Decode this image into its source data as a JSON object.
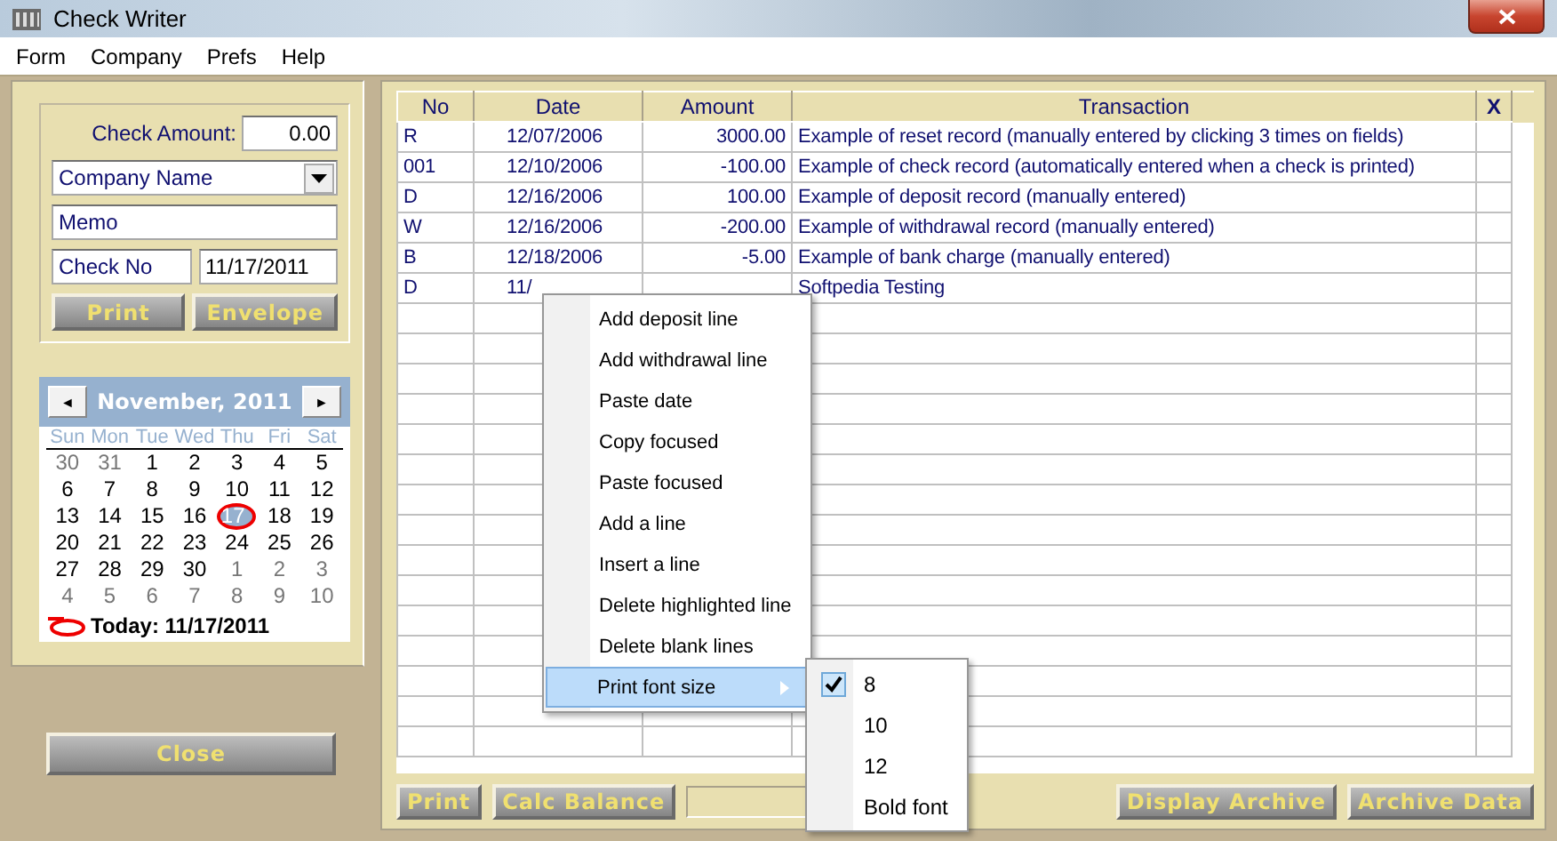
{
  "window": {
    "title": "Check Writer"
  },
  "menu": [
    "Form",
    "Company",
    "Prefs",
    "Help"
  ],
  "check_form": {
    "amount_label": "Check Amount:",
    "amount": "0.00",
    "company": "Company Name",
    "memo": "Memo",
    "check_no": "Check No",
    "date": "11/17/2011",
    "buttons": [
      "Print",
      "Envelope"
    ]
  },
  "calendar": {
    "month": "November, 2011",
    "prev": "◄",
    "next": "►",
    "weekdays": [
      "Sun",
      "Mon",
      "Tue",
      "Wed",
      "Thu",
      "Fri",
      "Sat"
    ],
    "weeks": [
      [
        {
          "day": "30",
          "other_month": true,
          "selected": false
        },
        {
          "day": "31",
          "other_month": true,
          "selected": false
        },
        {
          "day": "1",
          "other_month": false,
          "selected": false
        },
        {
          "day": "2",
          "other_month": false,
          "selected": false
        },
        {
          "day": "3",
          "other_month": false,
          "selected": false
        },
        {
          "day": "4",
          "other_month": false,
          "selected": false
        },
        {
          "day": "5",
          "other_month": false,
          "selected": false
        }
      ],
      [
        {
          "day": "6",
          "other_month": false,
          "selected": false
        },
        {
          "day": "7",
          "other_month": false,
          "selected": false
        },
        {
          "day": "8",
          "other_month": false,
          "selected": false
        },
        {
          "day": "9",
          "other_month": false,
          "selected": false
        },
        {
          "day": "10",
          "other_month": false,
          "selected": false
        },
        {
          "day": "11",
          "other_month": false,
          "selected": false
        },
        {
          "day": "12",
          "other_month": false,
          "selected": false
        }
      ],
      [
        {
          "day": "13",
          "other_month": false,
          "selected": false
        },
        {
          "day": "14",
          "other_month": false,
          "selected": false
        },
        {
          "day": "15",
          "other_month": false,
          "selected": false
        },
        {
          "day": "16",
          "other_month": false,
          "selected": false
        },
        {
          "day": "17",
          "other_month": false,
          "selected": true
        },
        {
          "day": "18",
          "other_month": false,
          "selected": false
        },
        {
          "day": "19",
          "other_month": false,
          "selected": false
        }
      ],
      [
        {
          "day": "20",
          "other_month": false,
          "selected": false
        },
        {
          "day": "21",
          "other_month": false,
          "selected": false
        },
        {
          "day": "22",
          "other_month": false,
          "selected": false
        },
        {
          "day": "23",
          "other_month": false,
          "selected": false
        },
        {
          "day": "24",
          "other_month": false,
          "selected": false
        },
        {
          "day": "25",
          "other_month": false,
          "selected": false
        },
        {
          "day": "26",
          "other_month": false,
          "selected": false
        }
      ],
      [
        {
          "day": "27",
          "other_month": false,
          "selected": false
        },
        {
          "day": "28",
          "other_month": false,
          "selected": false
        },
        {
          "day": "29",
          "other_month": false,
          "selected": false
        },
        {
          "day": "30",
          "other_month": false,
          "selected": false
        },
        {
          "day": "1",
          "other_month": true,
          "selected": false
        },
        {
          "day": "2",
          "other_month": true,
          "selected": false
        },
        {
          "day": "3",
          "other_month": true,
          "selected": false
        }
      ],
      [
        {
          "day": "4",
          "other_month": true,
          "selected": false
        },
        {
          "day": "5",
          "other_month": true,
          "selected": false
        },
        {
          "day": "6",
          "other_month": true,
          "selected": false
        },
        {
          "day": "7",
          "other_month": true,
          "selected": false
        },
        {
          "day": "8",
          "other_month": true,
          "selected": false
        },
        {
          "day": "9",
          "other_month": true,
          "selected": false
        },
        {
          "day": "10",
          "other_month": true,
          "selected": false
        }
      ]
    ],
    "today": "Today: 11/17/2011"
  },
  "close_button": "Close",
  "table": {
    "columns": [
      "No",
      "Date",
      "Amount",
      "Transaction",
      "X"
    ],
    "rows": [
      {
        "no": "R",
        "date": "12/07/2006",
        "amount": "3000.00",
        "transaction": "Example of reset record (manually entered by clicking 3 times on fields)"
      },
      {
        "no": "001",
        "date": "12/10/2006",
        "amount": "-100.00",
        "transaction": "Example of check record (automatically entered when a check is printed)"
      },
      {
        "no": "D",
        "date": "12/16/2006",
        "amount": "100.00",
        "transaction": "Example of deposit record (manually entered)"
      },
      {
        "no": "W",
        "date": "12/16/2006",
        "amount": "-200.00",
        "transaction": "Example of withdrawal record (manually entered)"
      },
      {
        "no": "B",
        "date": "12/18/2006",
        "amount": "-5.00",
        "transaction": "Example of bank charge (manually entered)"
      },
      {
        "no": "D",
        "date": "11/",
        "transaction": "Softpedia Testing"
      }
    ]
  },
  "bottom_buttons": [
    "Print",
    "Calc Balance",
    "Display Archive",
    "Archive Data"
  ],
  "context_menu": [
    {
      "label": "Add deposit line",
      "kind": "item",
      "highlighted": false
    },
    {
      "label": "Add withdrawal line",
      "kind": "item",
      "highlighted": false
    },
    {
      "label": "Paste date",
      "kind": "item",
      "highlighted": false
    },
    {
      "label": "Copy focused",
      "kind": "item",
      "highlighted": false
    },
    {
      "label": "Paste focused",
      "kind": "item",
      "highlighted": false
    },
    {
      "label": "Add a line",
      "kind": "item",
      "highlighted": false
    },
    {
      "label": "Insert a line",
      "kind": "item",
      "highlighted": false
    },
    {
      "label": "Delete highlighted line",
      "kind": "item",
      "highlighted": false
    },
    {
      "label": "Delete blank lines",
      "kind": "item",
      "highlighted": false
    },
    {
      "label": "Print font size",
      "kind": "submenu",
      "highlighted": true
    }
  ],
  "submenu": [
    {
      "label": "8",
      "checked": true
    },
    {
      "label": "10",
      "checked": false
    },
    {
      "label": "12",
      "checked": false
    },
    {
      "label": "Bold font",
      "checked": false
    }
  ]
}
